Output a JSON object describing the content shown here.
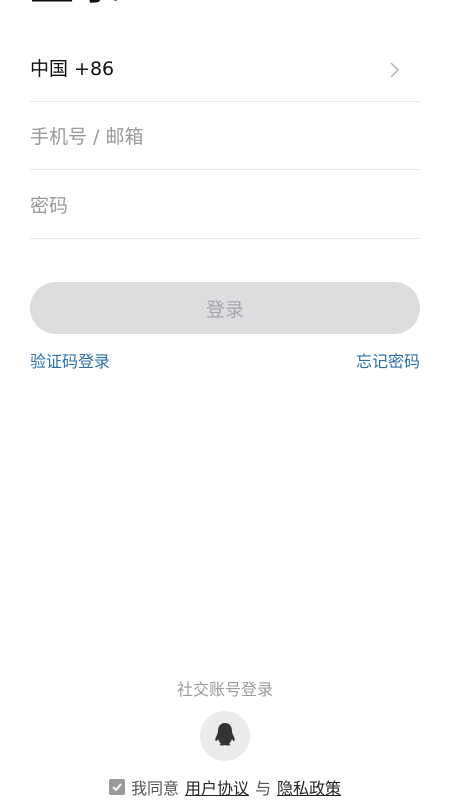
{
  "header": {
    "title_fragment": "登录"
  },
  "form": {
    "country_code": "中国 +86",
    "phone_placeholder": "手机号 / 邮箱",
    "password_placeholder": "密码",
    "login_button": "登录",
    "sms_login_link": "验证码登录",
    "forgot_password_link": "忘记密码"
  },
  "social": {
    "label": "社交账号登录",
    "icons": [
      "qq-penguin-icon"
    ]
  },
  "agreement": {
    "checked": true,
    "prefix": "我同意",
    "user_agreement": "用户协议",
    "conjunction": "与",
    "privacy_policy": "隐私政策"
  },
  "colors": {
    "link": "#2d6fa8",
    "button_bg": "#dedcdf",
    "placeholder": "#9a9a9a"
  }
}
